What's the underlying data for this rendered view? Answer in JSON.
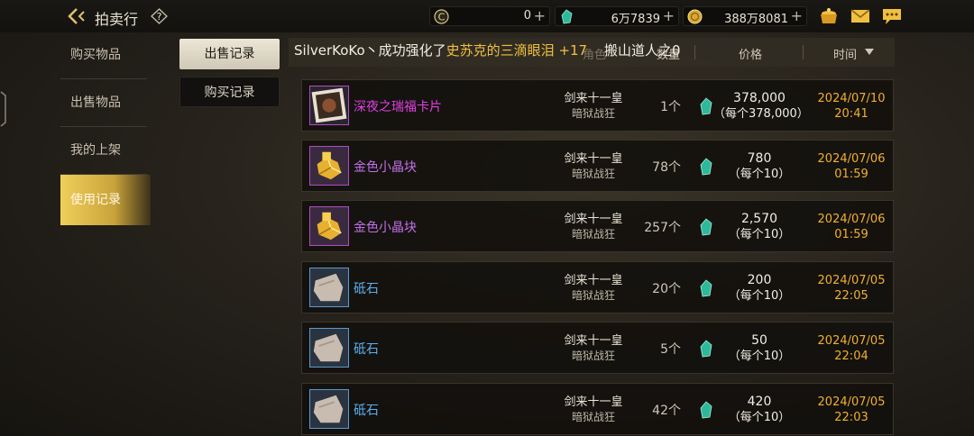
{
  "header": {
    "title": "拍卖行",
    "currencies": [
      {
        "icon": "coin-c-icon",
        "value": "0"
      },
      {
        "icon": "green-gem-icon",
        "value": "6万7839"
      },
      {
        "icon": "gold-coin-icon",
        "value": "388万8081"
      }
    ],
    "right_icons": [
      "treasure-pot-icon",
      "mail-icon",
      "chat-icon"
    ]
  },
  "sidebar": {
    "items": [
      {
        "label": "购买物品"
      },
      {
        "label": "出售物品"
      },
      {
        "label": "我的上架"
      },
      {
        "label": "使用记录"
      }
    ],
    "active_index": 3
  },
  "subtabs": [
    {
      "label": "出售记录"
    },
    {
      "label": "购买记录"
    }
  ],
  "table": {
    "columns": {
      "role": "角色",
      "qty": "数量",
      "price": "价格",
      "time": "时间"
    }
  },
  "broadcast": {
    "prefix": "SilverKoKo丶成功强化了",
    "item": "史苏克的三滴眼泪 +17",
    "overlay": "搬山道人之0"
  },
  "rows": [
    {
      "name": "深夜之瑞福卡片",
      "name_color": "#e040e0",
      "icon": "card-icon",
      "seller": "剑来十一皇",
      "class": "暗狱战狂",
      "qty": "1个",
      "price": "378,000",
      "unit_price": "（每个378,000）",
      "date": "2024/07/10",
      "time": "20:41"
    },
    {
      "name": "金色小晶块",
      "name_color": "#c070e8",
      "icon": "gold-crystal-icon",
      "seller": "剑来十一皇",
      "class": "暗狱战狂",
      "qty": "78个",
      "price": "780",
      "unit_price": "（每个10）",
      "date": "2024/07/06",
      "time": "01:59"
    },
    {
      "name": "金色小晶块",
      "name_color": "#c070e8",
      "icon": "gold-crystal-icon",
      "seller": "剑来十一皇",
      "class": "暗狱战狂",
      "qty": "257个",
      "price": "2,570",
      "unit_price": "（每个10）",
      "date": "2024/07/06",
      "time": "01:59"
    },
    {
      "name": "砥石",
      "name_color": "#5ab0f0",
      "icon": "whetstone-icon",
      "seller": "剑来十一皇",
      "class": "暗狱战狂",
      "qty": "20个",
      "price": "200",
      "unit_price": "（每个10）",
      "date": "2024/07/05",
      "time": "22:05"
    },
    {
      "name": "砥石",
      "name_color": "#5ab0f0",
      "icon": "whetstone-icon",
      "seller": "剑来十一皇",
      "class": "暗狱战狂",
      "qty": "5个",
      "price": "50",
      "unit_price": "（每个10）",
      "date": "2024/07/05",
      "time": "22:04"
    },
    {
      "name": "砥石",
      "name_color": "#5ab0f0",
      "icon": "whetstone-icon",
      "seller": "剑来十一皇",
      "class": "暗狱战狂",
      "qty": "42个",
      "price": "420",
      "unit_price": "（每个10）",
      "date": "2024/07/05",
      "time": "22:03"
    }
  ]
}
